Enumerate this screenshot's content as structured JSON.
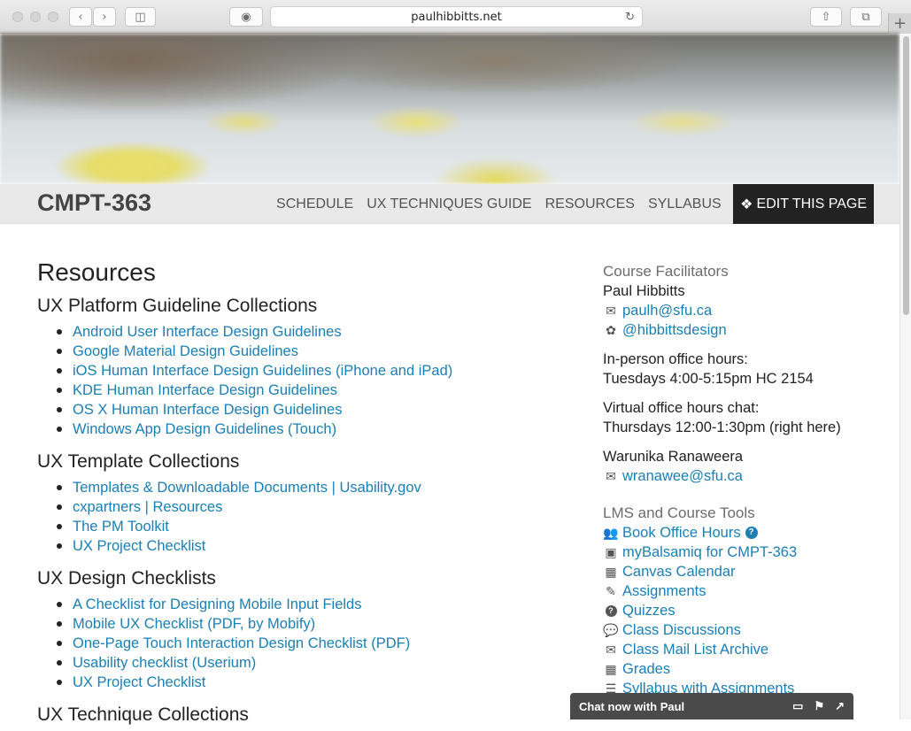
{
  "browser": {
    "url": "paulhibbitts.net"
  },
  "site": {
    "brand": "CMPT-363",
    "nav": [
      {
        "label": "SCHEDULE"
      },
      {
        "label": "UX TECHNIQUES GUIDE"
      },
      {
        "label": "RESOURCES"
      },
      {
        "label": "SYLLABUS"
      }
    ],
    "edit_label": "EDIT THIS PAGE"
  },
  "main": {
    "title": "Resources",
    "sections": [
      {
        "heading": "UX Platform Guideline Collections",
        "links": [
          "Android User Interface Design Guidelines",
          "Google Material Design Guidelines",
          "iOS Human Interface Design Guidelines (iPhone and iPad)",
          "KDE Human Interface Design Guidelines",
          "OS X Human Interface Design Guidelines",
          "Windows App Design Guidelines (Touch)"
        ]
      },
      {
        "heading": "UX Template Collections",
        "links": [
          "Templates & Downloadable Documents | Usability.gov",
          "cxpartners | Resources",
          "The PM Toolkit",
          "UX Project Checklist"
        ]
      },
      {
        "heading": "UX Design Checklists",
        "links": [
          "A Checklist for Designing Mobile Input Fields",
          "Mobile UX Checklist (PDF, by Mobify)",
          "One-Page Touch Interaction Design Checklist (PDF)",
          "Usability checklist (Userium)",
          "UX Project Checklist"
        ]
      },
      {
        "heading": "UX Technique Collections",
        "links": []
      }
    ]
  },
  "sidebar": {
    "facilitators_heading": "Course Facilitators",
    "name1": "Paul Hibbitts",
    "email1": "paulh@sfu.ca",
    "twitter": "@hibbittsdesign",
    "inperson_label": "In-person office hours:",
    "inperson_time": "Tuesdays 4:00-5:15pm HC 2154",
    "virtual_label": "Virtual office hours chat:",
    "virtual_time": "Thursdays 12:00-1:30pm (right here)",
    "name2": "Warunika Ranaweera",
    "email2": "wranawee@sfu.ca",
    "tools_heading": "LMS and Course Tools",
    "tools": [
      {
        "icon": "users-icon",
        "glyph": "👥",
        "label": "Book Office Hours"
      },
      {
        "icon": "balsamiq-icon",
        "glyph": "▣",
        "label": "myBalsamiq for CMPT-363"
      },
      {
        "icon": "calendar-icon",
        "glyph": "▦",
        "label": "Canvas Calendar"
      },
      {
        "icon": "pencil-icon",
        "glyph": "✎",
        "label": "Assignments"
      },
      {
        "icon": "question-icon",
        "glyph": "?",
        "label": "Quizzes"
      },
      {
        "icon": "comments-icon",
        "glyph": "💬",
        "label": "Class Discussions"
      },
      {
        "icon": "envelope-icon",
        "glyph": "✉",
        "label": "Class Mail List Archive"
      },
      {
        "icon": "calculator-icon",
        "glyph": "▦",
        "label": "Grades"
      },
      {
        "icon": "list-icon",
        "glyph": "☰",
        "label": "Syllabus with Assignments"
      }
    ]
  },
  "chat": {
    "label": "Chat now with Paul"
  }
}
